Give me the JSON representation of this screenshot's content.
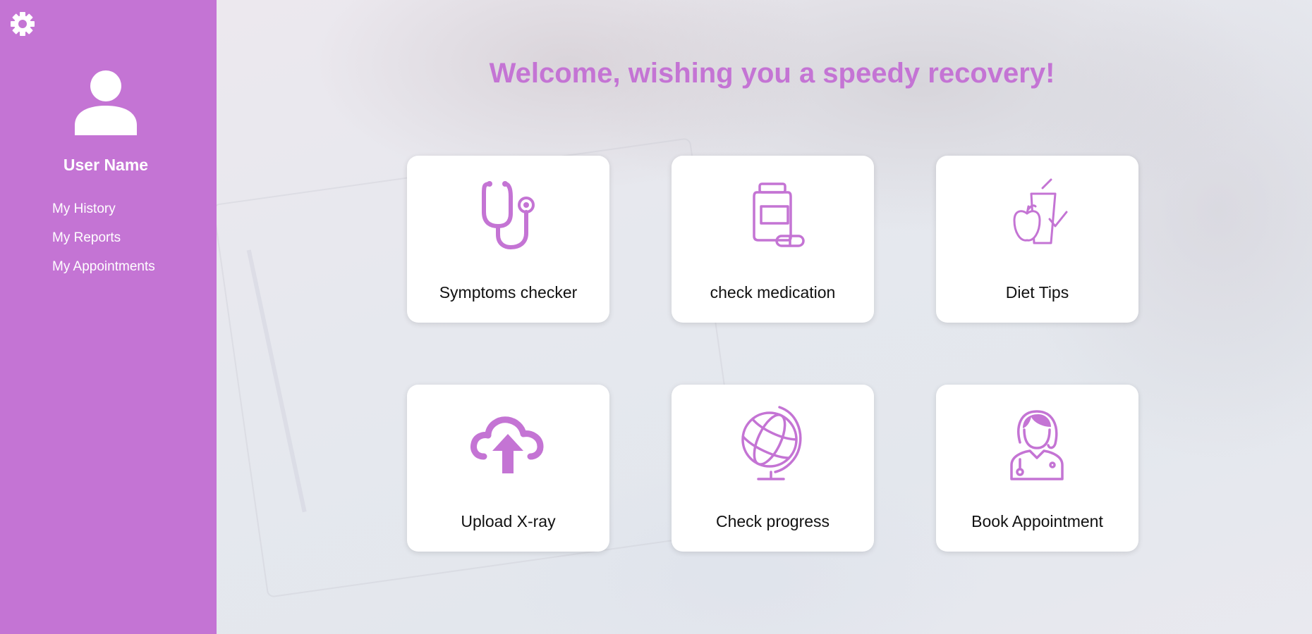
{
  "colors": {
    "accent": "#c474d4",
    "card_bg": "#ffffff",
    "label_text": "#111111"
  },
  "sidebar": {
    "user_name": "User Name",
    "settings_icon": "gear-icon",
    "avatar_icon": "user-avatar-icon",
    "items": [
      {
        "label": "My History"
      },
      {
        "label": "My Reports"
      },
      {
        "label": "My Appointments"
      }
    ]
  },
  "main": {
    "welcome": "Welcome, wishing you a speedy recovery!",
    "cards": [
      {
        "label": "Symptoms checker",
        "icon": "stethoscope-icon"
      },
      {
        "label": "check medication",
        "icon": "medication-bottle-icon"
      },
      {
        "label": "Diet Tips",
        "icon": "diet-apple-drink-icon"
      },
      {
        "label": "Upload X-ray",
        "icon": "cloud-upload-icon"
      },
      {
        "label": "Check progress",
        "icon": "globe-icon"
      },
      {
        "label": "Book Appointment",
        "icon": "doctor-icon"
      }
    ]
  }
}
